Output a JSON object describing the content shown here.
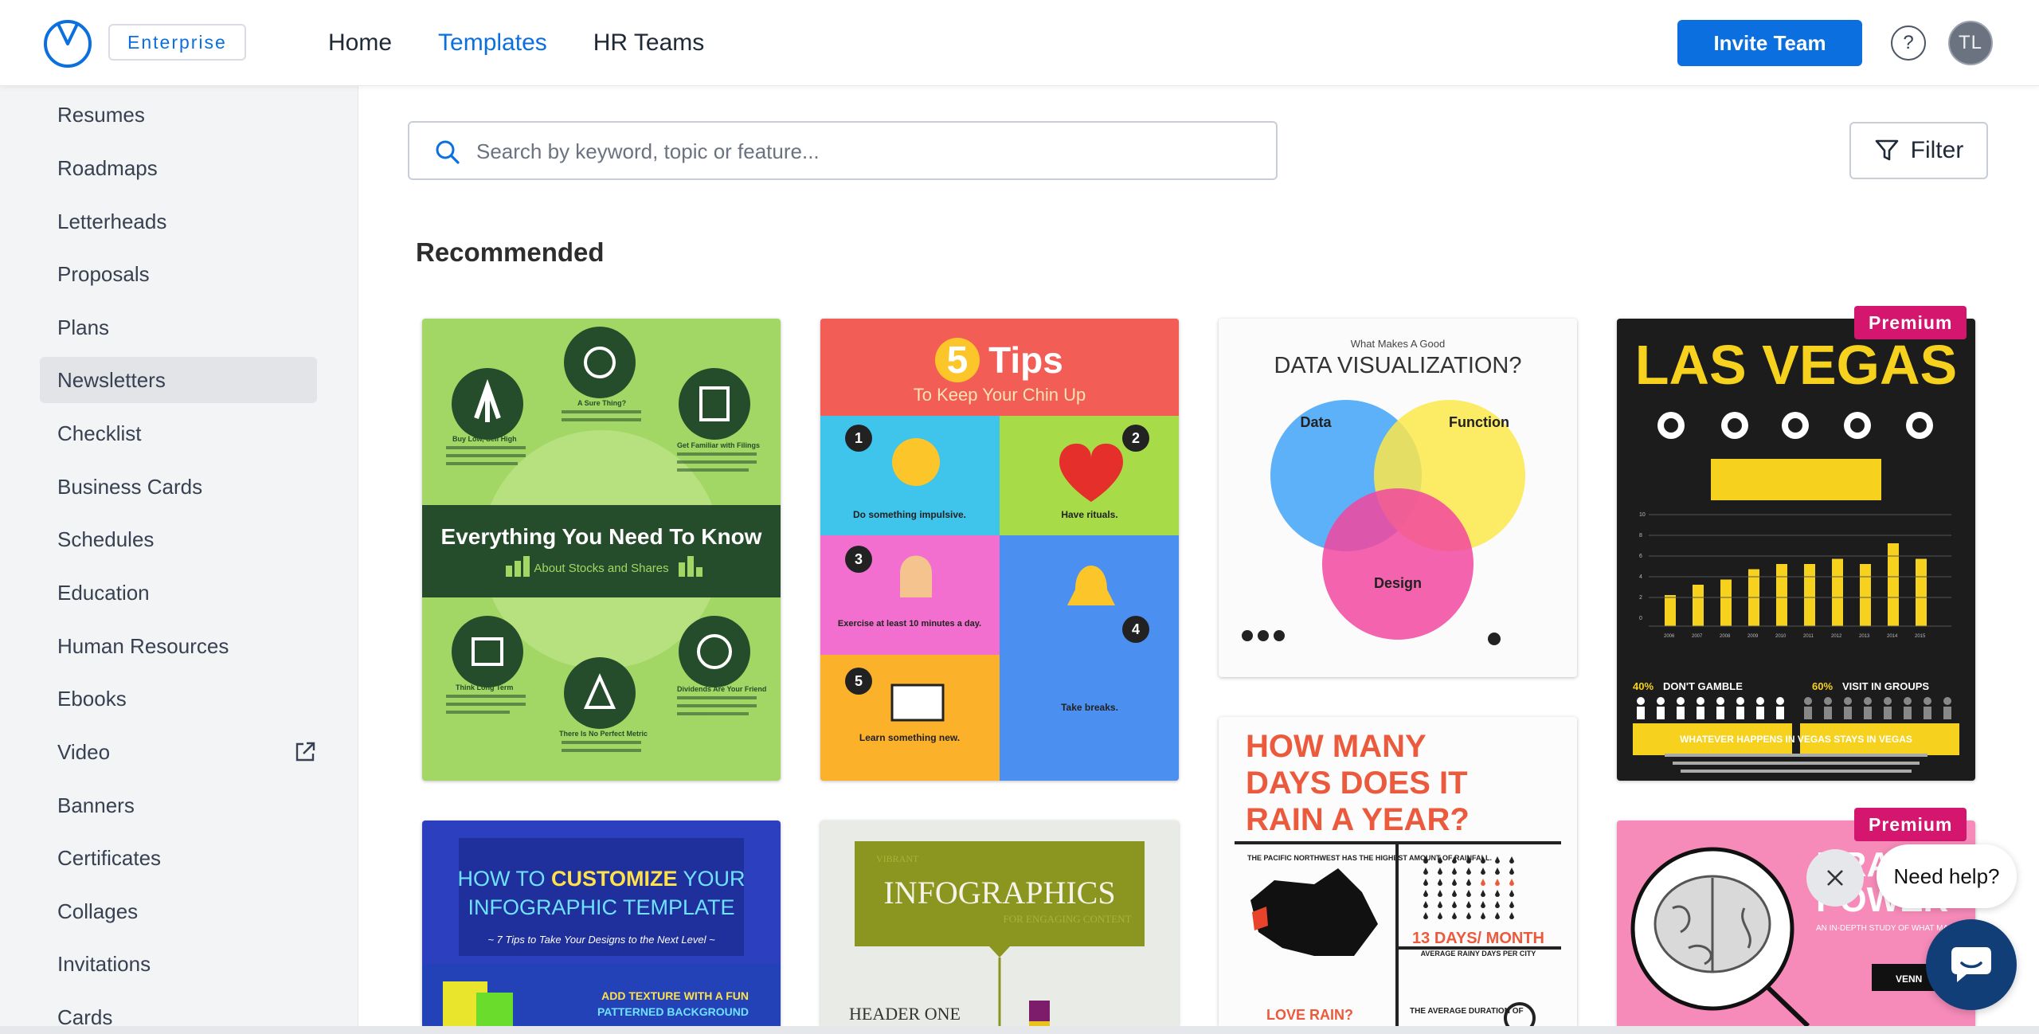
{
  "header": {
    "plan_badge": "Enterprise",
    "nav": [
      {
        "label": "Home",
        "active": false
      },
      {
        "label": "Templates",
        "active": true
      },
      {
        "label": "HR Teams",
        "active": false
      }
    ],
    "invite_label": "Invite Team",
    "help_label": "?",
    "avatar_initials": "TL",
    "accent_color": "#0b6fe0"
  },
  "sidebar": {
    "items": [
      {
        "label": "Resumes"
      },
      {
        "label": "Roadmaps"
      },
      {
        "label": "Letterheads"
      },
      {
        "label": "Proposals"
      },
      {
        "label": "Plans"
      },
      {
        "label": "Newsletters",
        "active": true
      },
      {
        "label": "Checklist"
      },
      {
        "label": "Business Cards"
      },
      {
        "label": "Schedules"
      },
      {
        "label": "Education"
      },
      {
        "label": "Human Resources"
      },
      {
        "label": "Ebooks"
      },
      {
        "label": "Video",
        "icon": "external-link-icon"
      },
      {
        "label": "Banners"
      },
      {
        "label": "Certificates"
      },
      {
        "label": "Collages"
      },
      {
        "label": "Invitations"
      },
      {
        "label": "Cards"
      }
    ]
  },
  "search": {
    "placeholder": "Search by keyword, topic or feature..."
  },
  "filter_label": "Filter",
  "section_title": "Recommended",
  "premium_label": "Premium",
  "cards": {
    "stocks": {
      "title": "Everything You Need To Know",
      "subtitle": "About Stocks and Shares",
      "items": [
        "Buy Low, Sell High",
        "A Sure Thing?",
        "Get Familiar with Filings",
        "Think Long Term",
        "There Is No Perfect Metric",
        "Dividends Are Your Friend"
      ]
    },
    "tips": {
      "big": "5",
      "title": "Tips",
      "subtitle": "To Keep Your Chin Up",
      "items": [
        "Do something impulsive.",
        "Have rituals.",
        "Exercise at least 10 minutes a day.",
        "Learn something new.",
        "Take breaks."
      ]
    },
    "dataviz": {
      "kicker": "What Makes A Good",
      "title": "DATA VISUALIZATION?",
      "circles": [
        "Data",
        "Function",
        "Design"
      ]
    },
    "vegas": {
      "title": "LAS VEGAS",
      "left_stat": "40%",
      "left_label": "DON'T GAMBLE",
      "right_stat": "60%",
      "right_label": "VISIT IN GROUPS",
      "footer": "WHATEVER HAPPENS IN VEGAS STAYS IN VEGAS",
      "y_ticks": [
        "10",
        "8",
        "6",
        "4",
        "2",
        "0"
      ],
      "years": [
        "2006",
        "2007",
        "2008",
        "2009",
        "2010",
        "2011",
        "2012",
        "2013",
        "2014",
        "2015"
      ],
      "bars": [
        3,
        4,
        4.5,
        5.5,
        6,
        6,
        6.5,
        6,
        8,
        6.5
      ]
    },
    "rain": {
      "title_lines": [
        "HOW MANY",
        "DAYS DOES IT",
        "RAIN A YEAR?"
      ],
      "note": "THE PACIFIC NORTHWEST HAS THE HIGHEST AMOUNT OF RAINFALL.",
      "stat": "13 DAYS/ MONTH",
      "stat_sub": "AVERAGE RAINY DAYS PER CITY",
      "love": "LOVE RAIN?",
      "average": "THE AVERAGE DURATION OF"
    },
    "customize": {
      "title_a": "HOW TO ",
      "title_b": "CUSTOMIZE",
      "title_c": " YOUR",
      "title_line2": "INFOGRAPHIC TEMPLATE",
      "tagline": "~ 7 Tips to Take Your Designs to the Next Level ~",
      "bottom": "ADD TEXTURE WITH A FUN",
      "bottom2": "PATTERNED BACKGROUND"
    },
    "vibrant": {
      "kicker": "VIBRANT",
      "title": "INFOGRAPHICS",
      "subtitle": "FOR ENGAGING CONTENT",
      "header": "HEADER ONE"
    },
    "brain": {
      "title": "BRAIN",
      "title2": "POWER",
      "subtitle": "AN IN-DEPTH STUDY OF WHAT MAKES US TICK",
      "brand": "VENN"
    }
  },
  "chat": {
    "help_text": "Need help?"
  }
}
